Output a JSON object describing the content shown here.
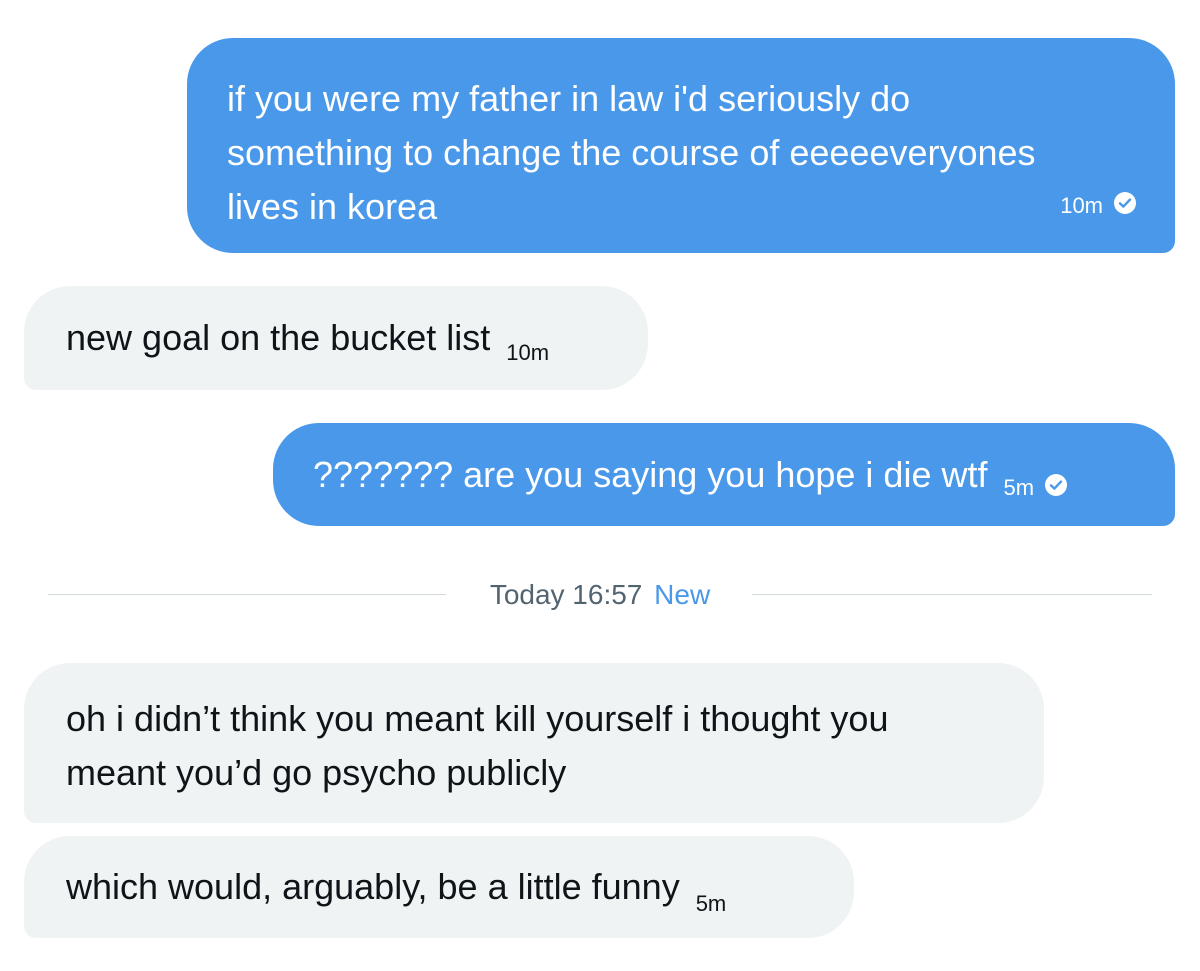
{
  "conversation": {
    "messages": [
      {
        "direction": "sent",
        "text": "if you were my father in law i'd seriously do\nsomething to change the course of eeeeeveryones\nlives in korea",
        "time": "10m",
        "seen": true
      },
      {
        "direction": "received",
        "text": "new goal on the bucket list",
        "time": "10m"
      },
      {
        "direction": "sent",
        "text": "??????? are you saying you hope i die wtf",
        "time": "5m",
        "seen": true
      },
      {
        "direction": "received",
        "text": "oh i didn’t think you meant kill yourself i thought you\nmeant you’d go psycho publicly",
        "time": ""
      },
      {
        "direction": "received",
        "text": "which would, arguably, be a little funny",
        "time": "5m"
      }
    ],
    "divider": {
      "label": "Today 16:57",
      "new_label": "New"
    }
  },
  "colors": {
    "sent_bubble": "#4a98e9",
    "received_bubble": "#eff3f4",
    "accent": "#4a98e9",
    "divider_text": "#536471",
    "divider_line": "#cfd9de"
  },
  "icons": {
    "seen": "check-circle-icon"
  }
}
